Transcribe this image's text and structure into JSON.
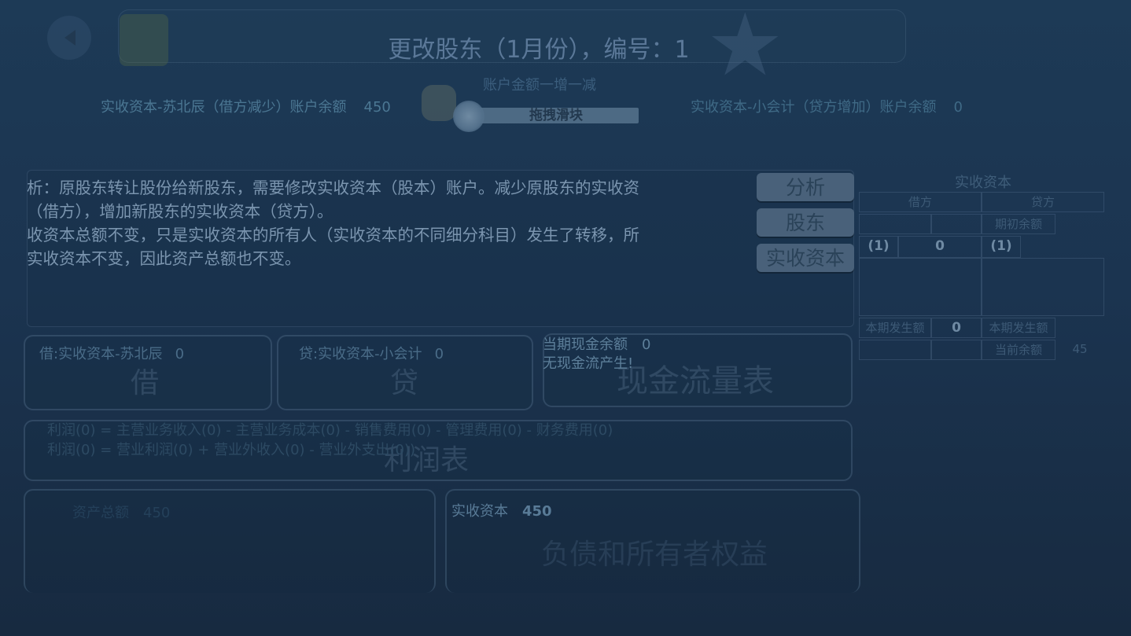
{
  "header": {
    "title": "更改股东（1月份），编号：1"
  },
  "slider": {
    "caption": "账户金额一增一减",
    "label": "拖拽滑块"
  },
  "accounts": {
    "left_label": "实收资本-苏北辰（借方减少）账户余额",
    "left_value": "450",
    "right_label": "实收资本-小会计（贷方增加）账户余额",
    "right_value": "0"
  },
  "description": "析：原股东转让股份给新股东，需要修改实收资本（股本）账户。减少原股东的实收资\n（借方），增加新股东的实收资本（贷方）。\n收资本总额不变，只是实收资本的所有人（实收资本的不同细分科目）发生了转移，所\n实收资本不变，因此资产总额也不变。",
  "side_buttons": [
    "分析",
    "股东",
    "实收资本"
  ],
  "ledger": {
    "title": "实收资本",
    "debit_header": "借方",
    "credit_header": "贷方",
    "opening_label": "期初余额",
    "row1": [
      "(1)",
      "0",
      "(1)"
    ],
    "period_label_left": "本期发生额",
    "period_value_left": "0",
    "period_label_right": "本期发生额",
    "current_label": "当前余额",
    "current_value": "45"
  },
  "debit_box": {
    "label": "借:实收资本-苏北辰",
    "value": "0",
    "ghost": "借"
  },
  "credit_box": {
    "label": "贷:实收资本-小会计",
    "value": "0",
    "ghost": "贷"
  },
  "cashflow_box": {
    "label": "当期现金余额",
    "value": "0",
    "note": "无现金流产生!",
    "ghost": "现金流量表"
  },
  "profit_box": {
    "line1": "利润(0) = 主营业务收入(0) - 主营业务成本(0) - 销售费用(0) - 管理费用(0) - 财务费用(0)",
    "line2": "利润(0) = 营业利润(0) + 营业外收入(0) - 营业外支出(0))",
    "ghost": "利润表"
  },
  "bottom_left": {
    "label": "资产总额",
    "value": "450"
  },
  "bottom_right": {
    "label": "实收资本",
    "value": "450",
    "ghost": "负债和所有者权益"
  }
}
